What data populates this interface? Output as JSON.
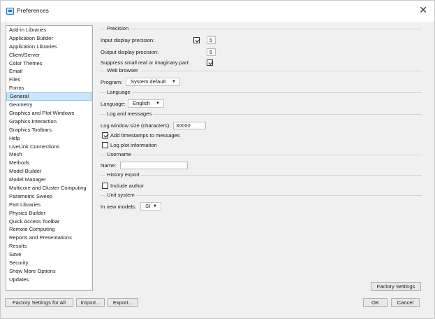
{
  "window": {
    "title": "Preferences",
    "close_glyph": "✕"
  },
  "tree": {
    "items": [
      "Add-in Libraries",
      "Application Builder",
      "Application Libraries",
      "Client/Server",
      "Color Themes",
      "Email",
      "Files",
      "Forms",
      "General",
      "Geometry",
      "Graphics and Plot Windows",
      "Graphics Interaction",
      "Graphics Toolbars",
      "Help",
      "LiveLink Connections",
      "Mesh",
      "Methods",
      "Model Builder",
      "Model Manager",
      "Multicore and Cluster Computing",
      "Parametric Sweep",
      "Part Libraries",
      "Physics Builder",
      "Quick Access Toolbar",
      "Remote Computing",
      "Reports and Presentations",
      "Results",
      "Save",
      "Security",
      "Show More Options",
      "Updates"
    ],
    "selected": "General"
  },
  "precision": {
    "title": "Precision",
    "input_label": "Input display precision:",
    "input_checked": true,
    "input_value": "5",
    "output_label": "Output display precision:",
    "output_value": "5",
    "suppress_label": "Suppress small real or imaginary part:",
    "suppress_checked": true
  },
  "web_browser": {
    "title": "Web browser",
    "program_label": "Program:",
    "program_value": "System default"
  },
  "language": {
    "title": "Language",
    "label": "Language:",
    "value": "English"
  },
  "log": {
    "title": "Log and messages",
    "window_size_label": "Log window size (characters):",
    "window_size_value": "30000",
    "timestamps_label": "Add timestamps to messages",
    "timestamps_checked": true,
    "plot_info_label": "Log plot information",
    "plot_info_checked": false
  },
  "username": {
    "title": "Username",
    "name_label": "Name:",
    "name_value": ""
  },
  "history": {
    "title": "History export",
    "include_author_label": "Include author",
    "include_author_checked": false
  },
  "unit_system": {
    "title": "Unit system",
    "label": "In new models:",
    "value": "SI"
  },
  "buttons": {
    "factory_settings": "Factory Settings",
    "factory_settings_all": "Factory Settings for All",
    "import": "Import...",
    "export": "Export...",
    "ok": "OK",
    "cancel": "Cancel"
  },
  "icons": {
    "dropdown": "▼"
  }
}
